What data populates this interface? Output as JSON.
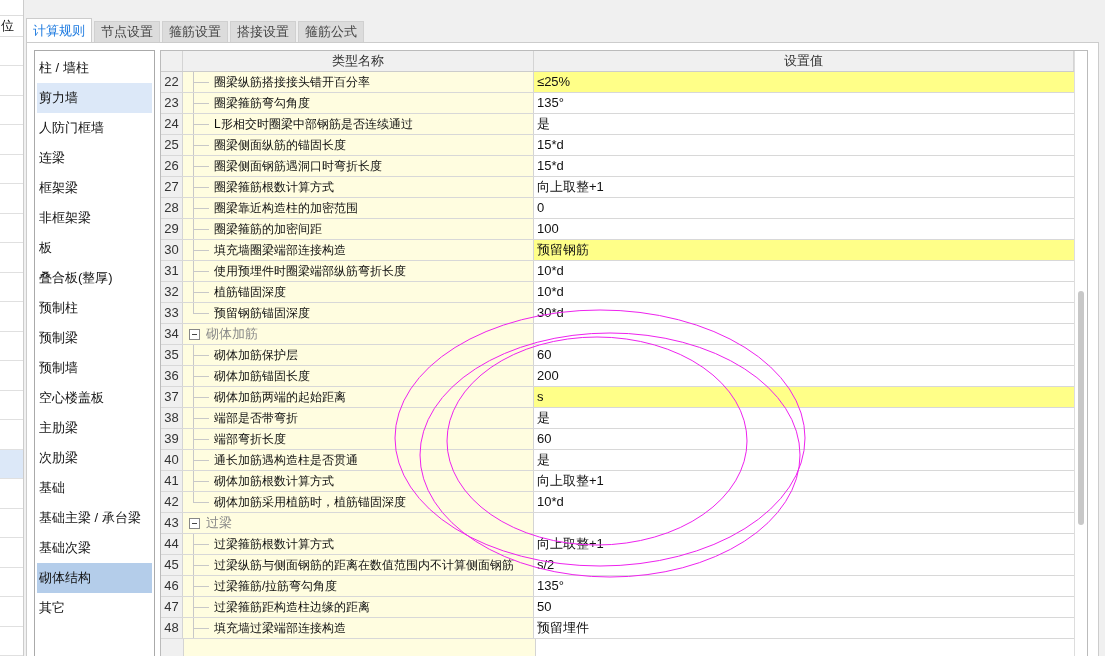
{
  "side_strip": {
    "label": "位",
    "highlighted_row": true
  },
  "tabs": [
    {
      "label": "计算规则",
      "selected": true
    },
    {
      "label": "节点设置",
      "selected": false
    },
    {
      "label": "箍筋设置",
      "selected": false
    },
    {
      "label": "搭接设置",
      "selected": false
    },
    {
      "label": "箍筋公式",
      "selected": false
    }
  ],
  "categories": [
    {
      "label": "柱 / 墙柱",
      "selected": false,
      "hovered": false
    },
    {
      "label": "剪力墙",
      "selected": false,
      "hovered": true
    },
    {
      "label": "人防门框墙",
      "selected": false,
      "hovered": false
    },
    {
      "label": "连梁",
      "selected": false,
      "hovered": false
    },
    {
      "label": "框架梁",
      "selected": false,
      "hovered": false
    },
    {
      "label": "非框架梁",
      "selected": false,
      "hovered": false
    },
    {
      "label": "板",
      "selected": false,
      "hovered": false
    },
    {
      "label": "叠合板(整厚)",
      "selected": false,
      "hovered": false
    },
    {
      "label": "预制柱",
      "selected": false,
      "hovered": false
    },
    {
      "label": "预制梁",
      "selected": false,
      "hovered": false
    },
    {
      "label": "预制墙",
      "selected": false,
      "hovered": false
    },
    {
      "label": "空心楼盖板",
      "selected": false,
      "hovered": false
    },
    {
      "label": "主肋梁",
      "selected": false,
      "hovered": false
    },
    {
      "label": "次肋梁",
      "selected": false,
      "hovered": false
    },
    {
      "label": "基础",
      "selected": false,
      "hovered": false
    },
    {
      "label": "基础主梁 / 承台梁",
      "selected": false,
      "hovered": false
    },
    {
      "label": "基础次梁",
      "selected": false,
      "hovered": false
    },
    {
      "label": "砌体结构",
      "selected": true,
      "hovered": false
    },
    {
      "label": "其它",
      "selected": false,
      "hovered": false
    }
  ],
  "table": {
    "columns": [
      "类型名称",
      "设置值"
    ],
    "rows": [
      {
        "kind": "item",
        "number": "22",
        "name": "圈梁纵筋搭接接头错开百分率",
        "value": "≤25%",
        "highlighted": true,
        "last": false
      },
      {
        "kind": "item",
        "number": "23",
        "name": "圈梁箍筋弯勾角度",
        "value": "135°",
        "highlighted": false,
        "last": false
      },
      {
        "kind": "item",
        "number": "24",
        "name": "L形相交时圈梁中部钢筋是否连续通过",
        "value": "是",
        "highlighted": false,
        "last": false
      },
      {
        "kind": "item",
        "number": "25",
        "name": "圈梁侧面纵筋的锚固长度",
        "value": "15*d",
        "highlighted": false,
        "last": false
      },
      {
        "kind": "item",
        "number": "26",
        "name": "圈梁侧面钢筋遇洞口时弯折长度",
        "value": "15*d",
        "highlighted": false,
        "last": false
      },
      {
        "kind": "item",
        "number": "27",
        "name": "圈梁箍筋根数计算方式",
        "value": "向上取整+1",
        "highlighted": false,
        "last": false
      },
      {
        "kind": "item",
        "number": "28",
        "name": "圈梁靠近构造柱的加密范围",
        "value": "0",
        "highlighted": false,
        "last": false
      },
      {
        "kind": "item",
        "number": "29",
        "name": "圈梁箍筋的加密间距",
        "value": "100",
        "highlighted": false,
        "last": false
      },
      {
        "kind": "item",
        "number": "30",
        "name": "填充墙圈梁端部连接构造",
        "value": "预留钢筋",
        "highlighted": true,
        "last": false
      },
      {
        "kind": "item",
        "number": "31",
        "name": "使用预埋件时圈梁端部纵筋弯折长度",
        "value": "10*d",
        "highlighted": false,
        "last": false
      },
      {
        "kind": "item",
        "number": "32",
        "name": "植筋锚固深度",
        "value": "10*d",
        "highlighted": false,
        "last": false
      },
      {
        "kind": "item",
        "number": "33",
        "name": "预留钢筋锚固深度",
        "value": "30*d",
        "highlighted": false,
        "last": true
      },
      {
        "kind": "group",
        "number": "34",
        "name": "砌体加筋",
        "expanded": true
      },
      {
        "kind": "item",
        "number": "35",
        "name": "砌体加筋保护层",
        "value": "60",
        "highlighted": false,
        "last": false
      },
      {
        "kind": "item",
        "number": "36",
        "name": "砌体加筋锚固长度",
        "value": "200",
        "highlighted": false,
        "last": false
      },
      {
        "kind": "item",
        "number": "37",
        "name": "砌体加筋两端的起始距离",
        "value": "s",
        "highlighted": true,
        "last": false
      },
      {
        "kind": "item",
        "number": "38",
        "name": "端部是否带弯折",
        "value": "是",
        "highlighted": false,
        "last": false
      },
      {
        "kind": "item",
        "number": "39",
        "name": "端部弯折长度",
        "value": "60",
        "highlighted": false,
        "last": false
      },
      {
        "kind": "item",
        "number": "40",
        "name": "通长加筋遇构造柱是否贯通",
        "value": "是",
        "highlighted": false,
        "last": false
      },
      {
        "kind": "item",
        "number": "41",
        "name": "砌体加筋根数计算方式",
        "value": "向上取整+1",
        "highlighted": false,
        "last": false
      },
      {
        "kind": "item",
        "number": "42",
        "name": "砌体加筋采用植筋时，植筋锚固深度",
        "value": "10*d",
        "highlighted": false,
        "last": true
      },
      {
        "kind": "group",
        "number": "43",
        "name": "过梁",
        "expanded": true
      },
      {
        "kind": "item",
        "number": "44",
        "name": "过梁箍筋根数计算方式",
        "value": "向上取整+1",
        "highlighted": false,
        "last": false
      },
      {
        "kind": "item",
        "number": "45",
        "name": "过梁纵筋与侧面钢筋的距离在数值范围内不计算侧面钢筋",
        "value": "s/2",
        "highlighted": false,
        "last": false
      },
      {
        "kind": "item",
        "number": "46",
        "name": "过梁箍筋/拉筋弯勾角度",
        "value": "135°",
        "highlighted": false,
        "last": false
      },
      {
        "kind": "item",
        "number": "47",
        "name": "过梁箍筋距构造柱边缘的距离",
        "value": "50",
        "highlighted": false,
        "last": false
      },
      {
        "kind": "item",
        "number": "48",
        "name": "填充墙过梁端部连接构造",
        "value": "预留埋件",
        "highlighted": false,
        "last": false
      }
    ]
  }
}
